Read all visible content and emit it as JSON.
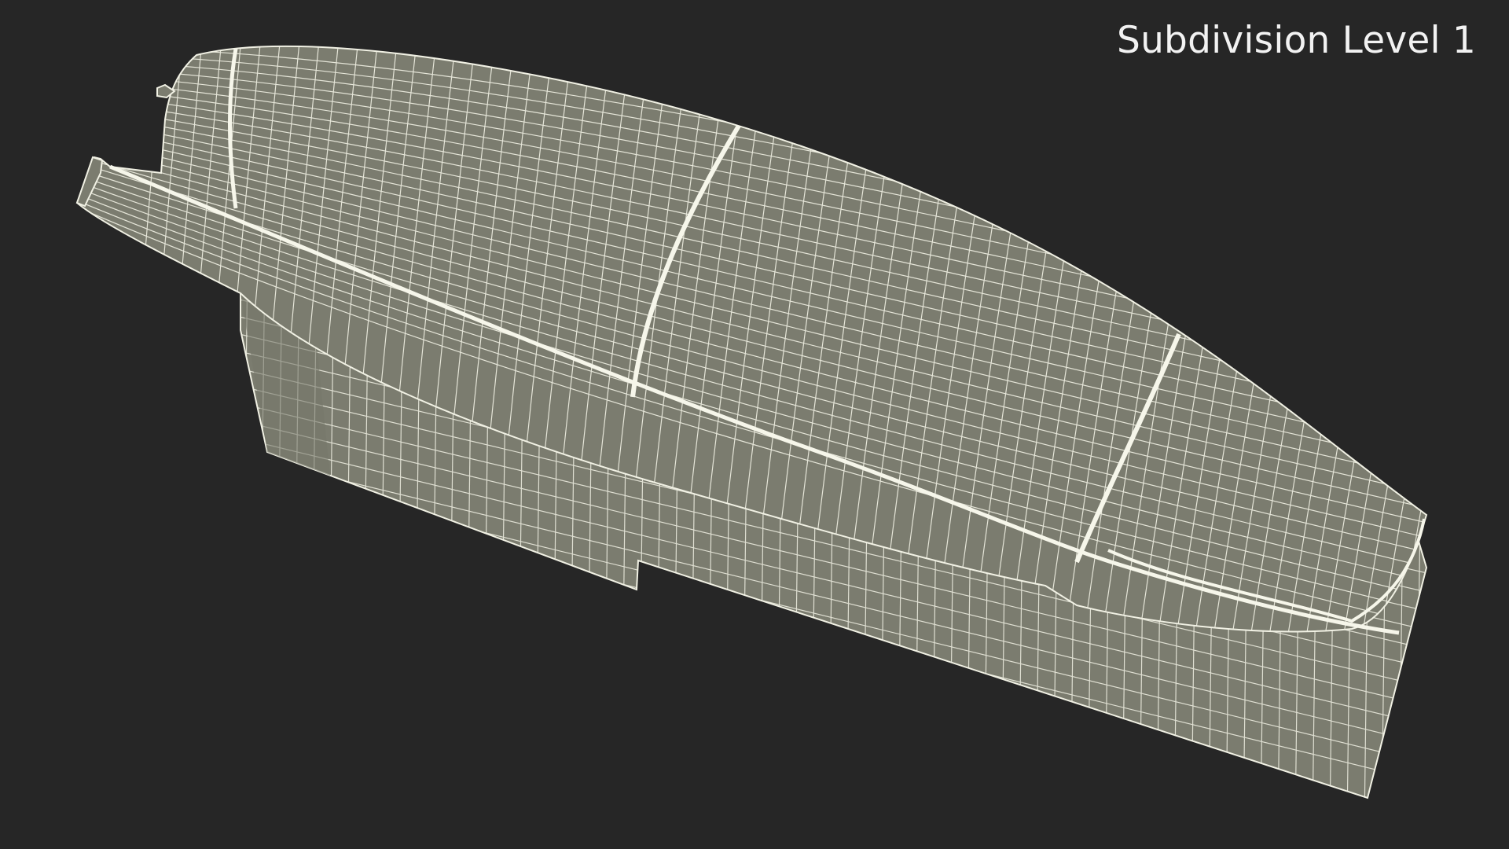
{
  "render": {
    "label": "Subdivision Level 1"
  },
  "colors": {
    "background": "#262626",
    "surface": "#7b7c6f",
    "surface_dark": "#6e6f63",
    "wire": "#f1f1e4",
    "label": "#f2f2f2"
  },
  "model": {
    "subject": "wireframe-3d-model",
    "display_mode": "wireframe-on-shaded"
  }
}
